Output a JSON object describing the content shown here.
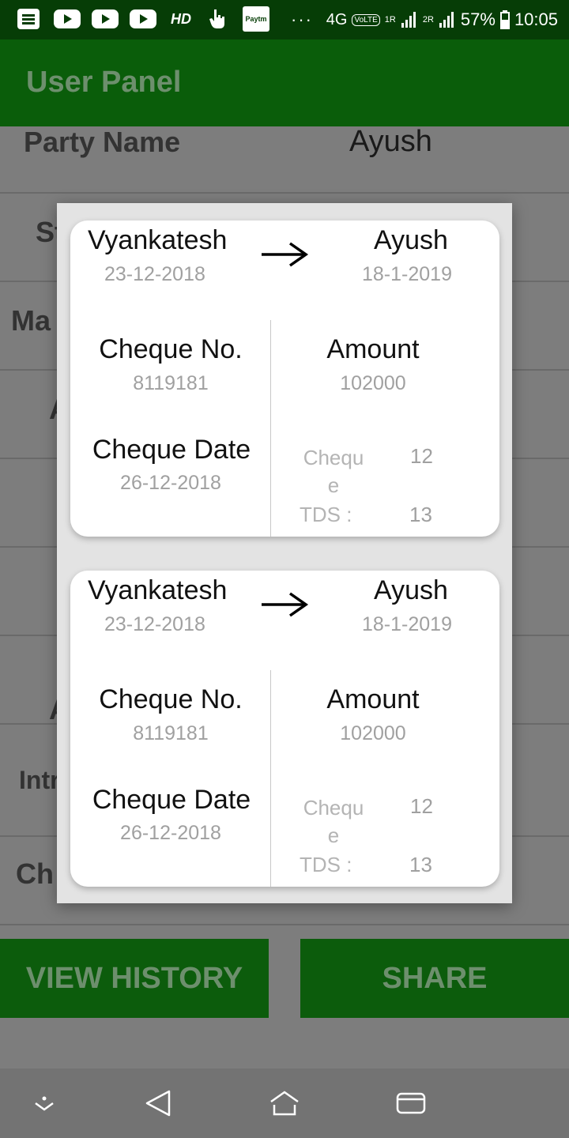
{
  "status_bar": {
    "hd": "HD",
    "paytm": "Paytm",
    "dots": "···",
    "network": "4G",
    "volte": "VoLTE",
    "sim1": "1R",
    "sim2": "2R",
    "battery": "57%",
    "time": "10:05"
  },
  "app_bar": {
    "title": "User Panel"
  },
  "form": {
    "party_label": "Party Name",
    "party_value": "Ayush",
    "row2_label": "St",
    "row3_label": "Ma",
    "row4_label": "A",
    "row8_label": "A",
    "row9_label": "Intr",
    "row10_label": "Ch"
  },
  "buttons": {
    "view_history": "VIEW HISTORY",
    "share": "SHARE"
  },
  "records": [
    {
      "from_name": "Vyankatesh",
      "from_date": "23-12-2018",
      "to_name": "Ayush",
      "to_date": "18-1-2019",
      "cheque_no_label": "Cheque No.",
      "cheque_no": "8119181",
      "amount_label": "Amount",
      "amount": "102000",
      "cheque_date_label": "Cheque Date",
      "cheque_date": "26-12-2018",
      "cheque_label": "Cheque",
      "cheque_value": "12",
      "tds_label": "TDS  :",
      "tds_value": "13"
    },
    {
      "from_name": "Vyankatesh",
      "from_date": "23-12-2018",
      "to_name": "Ayush",
      "to_date": "18-1-2019",
      "cheque_no_label": "Cheque No.",
      "cheque_no": "8119181",
      "amount_label": "Amount",
      "amount": "102000",
      "cheque_date_label": "Cheque Date",
      "cheque_date": "26-12-2018",
      "cheque_label": "Cheque",
      "cheque_value": "12",
      "tds_label": "TDS  :",
      "tds_value": "13"
    }
  ],
  "icons": {
    "status": [
      "news-icon",
      "youtube-icon",
      "hand-icon",
      "paytm-icon",
      "signal-icon",
      "battery-icon"
    ],
    "nav": [
      "dropdown-icon",
      "back-icon",
      "home-icon",
      "recents-icon"
    ],
    "arrow": "arrow-right-icon"
  },
  "colors": {
    "primary": "#0a5d0a",
    "status_bar": "#063d06",
    "secondary_text": "#a0a0a0"
  }
}
